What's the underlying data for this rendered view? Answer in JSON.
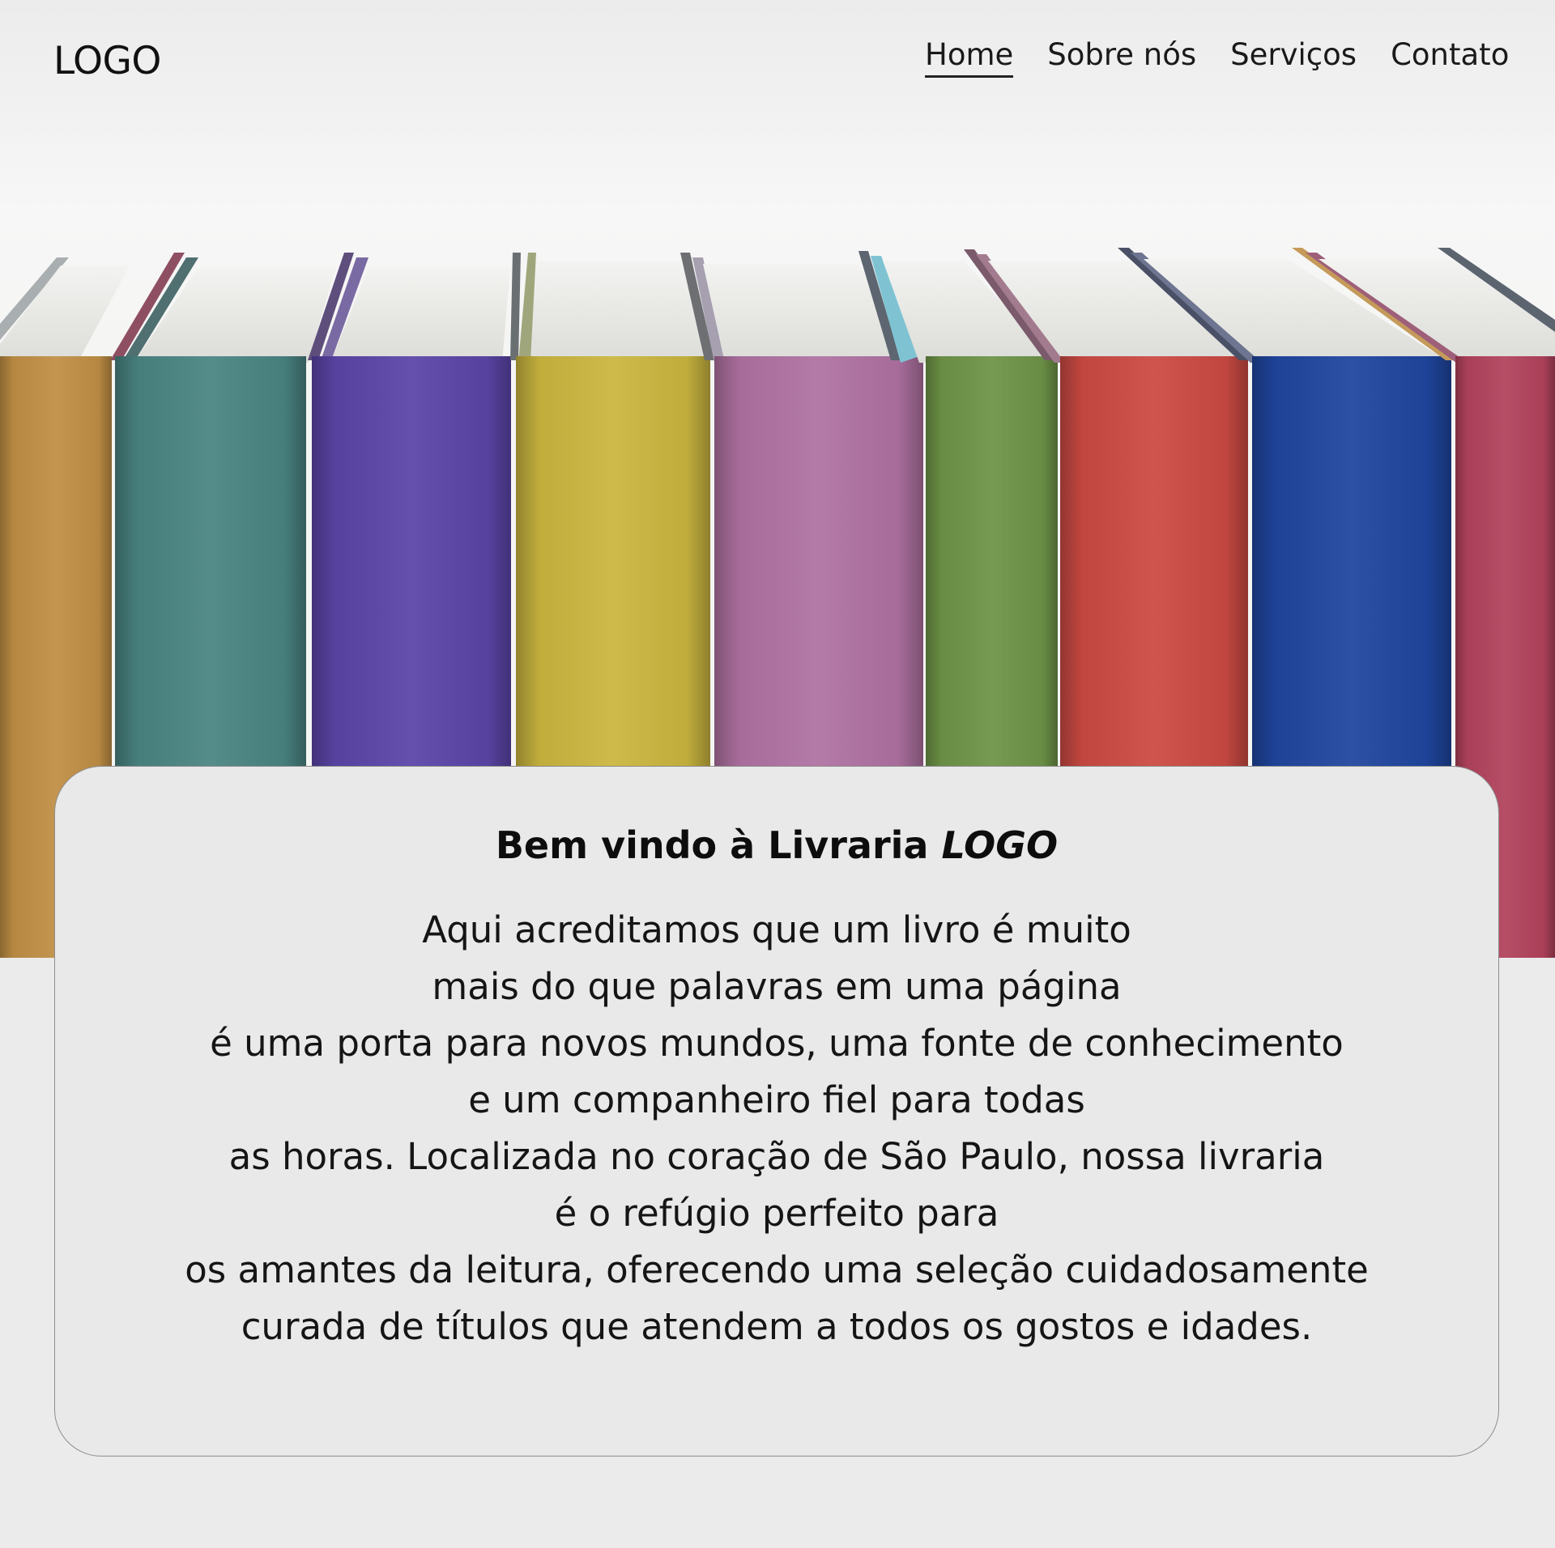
{
  "header": {
    "logo": "LOGO",
    "nav": [
      {
        "label": "Home",
        "active": true
      },
      {
        "label": "Sobre nós",
        "active": false
      },
      {
        "label": "Serviços",
        "active": false
      },
      {
        "label": "Contato",
        "active": false
      }
    ]
  },
  "hero": {
    "image": "row-of-colorful-books",
    "spine_colors": [
      "#c08f45",
      "#4a8583",
      "#5c45a8",
      "#cab63f",
      "#b072a2",
      "#6e9447",
      "#cc4a43",
      "#1f469f",
      "#b2435d"
    ]
  },
  "welcome": {
    "title_prefix": "Bem vindo à Livraria ",
    "title_brand": "LOGO",
    "lines": [
      "Aqui acreditamos que um livro é muito",
      "mais do que palavras em uma página",
      "é uma porta para novos mundos, uma fonte de conhecimento",
      "e um companheiro fiel para todas",
      "as horas. Localizada no coração de São Paulo, nossa livraria",
      "é o refúgio perfeito para",
      "os amantes da leitura, oferecendo uma seleção cuidadosamente",
      "curada de títulos que atendem a todos os gostos e idades."
    ]
  }
}
